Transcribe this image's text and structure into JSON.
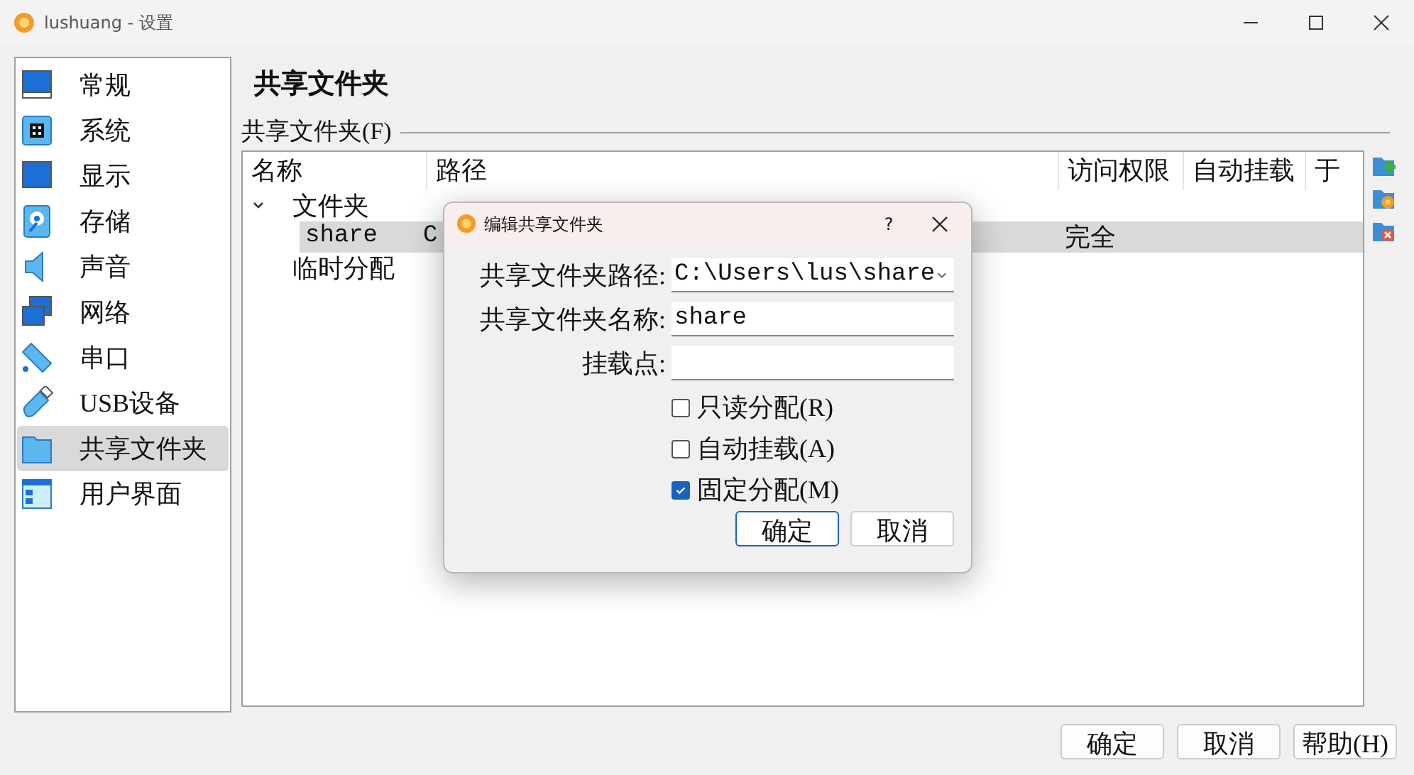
{
  "window": {
    "title": "lushuang - 设置"
  },
  "sidebar": {
    "items": [
      {
        "label": "常规",
        "kind": "general",
        "selected": false
      },
      {
        "label": "系统",
        "kind": "system",
        "selected": false
      },
      {
        "label": "显示",
        "kind": "display",
        "selected": false
      },
      {
        "label": "存储",
        "kind": "storage",
        "selected": false
      },
      {
        "label": "声音",
        "kind": "audio",
        "selected": false
      },
      {
        "label": "网络",
        "kind": "network",
        "selected": false
      },
      {
        "label": "串口",
        "kind": "serial",
        "selected": false
      },
      {
        "label": "USB设备",
        "kind": "usb",
        "selected": false
      },
      {
        "label": "共享文件夹",
        "kind": "folder",
        "selected": true
      },
      {
        "label": "用户界面",
        "kind": "ui",
        "selected": false
      }
    ]
  },
  "page": {
    "title": "共享文件夹",
    "group_label": "共享文件夹(F)"
  },
  "table": {
    "columns": [
      "名称",
      "路径",
      "访问权限",
      "自动挂载",
      "于"
    ],
    "groups": [
      {
        "label": "文件夹",
        "expanded": true,
        "children": [
          {
            "name": "share",
            "path": "C",
            "access": "完全",
            "selected": true
          }
        ]
      },
      {
        "label": "临时分配"
      }
    ]
  },
  "dialog": {
    "title": "编辑共享文件夹",
    "help": "?",
    "fields": [
      {
        "label": "共享文件夹路径:",
        "kind": "combo",
        "value": "C:\\Users\\lus\\share"
      },
      {
        "label": "共享文件夹名称:",
        "kind": "text",
        "value": "share"
      },
      {
        "label": "挂载点:",
        "kind": "text"
      }
    ],
    "checkboxes": [
      {
        "label": "只读分配(R)",
        "checked": false
      },
      {
        "label": "自动挂载(A)",
        "checked": false
      },
      {
        "label": "固定分配(M)",
        "checked": true
      }
    ],
    "buttons": [
      {
        "label": "确定",
        "default": true
      },
      {
        "label": "取消",
        "default": false
      }
    ]
  },
  "buttons": [
    "确定",
    "取消",
    "帮助(H)"
  ]
}
